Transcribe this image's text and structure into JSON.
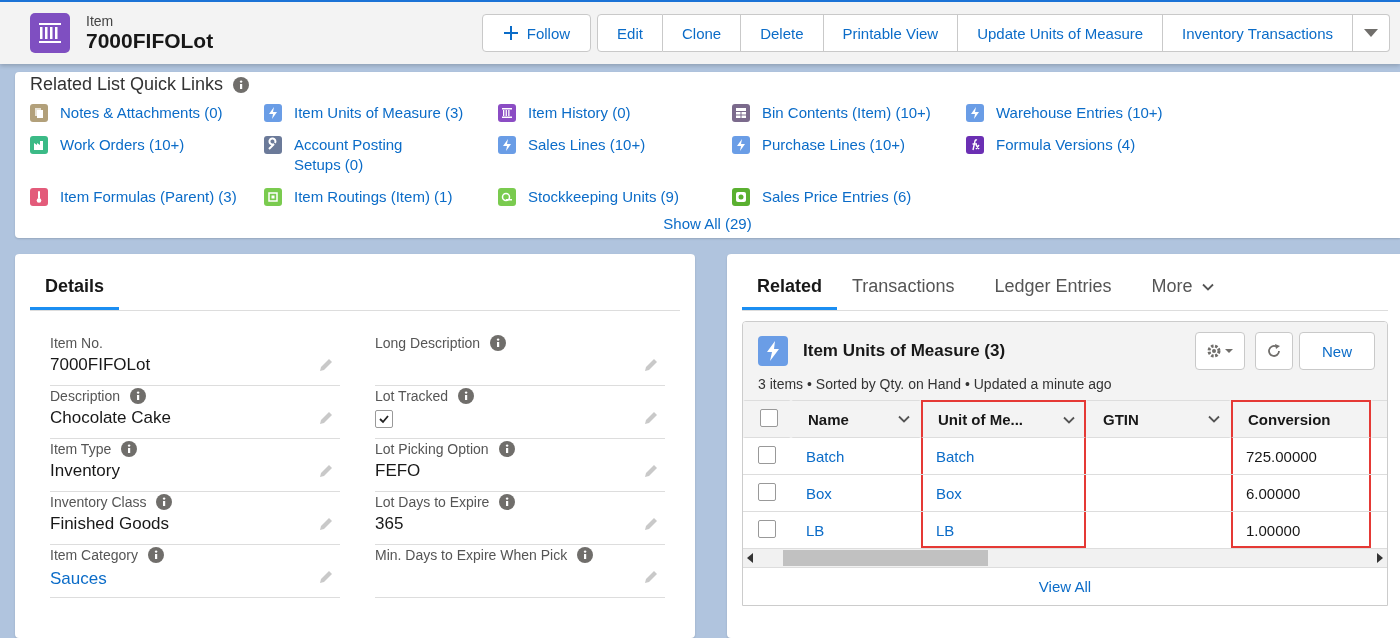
{
  "header": {
    "object_label": "Item",
    "record_name": "7000FIFOLot",
    "follow_button": "Follow",
    "actions": [
      "Edit",
      "Clone",
      "Delete",
      "Printable View",
      "Update Units of Measure",
      "Inventory Transactions"
    ]
  },
  "quick_links": {
    "title": "Related List Quick Links",
    "links": [
      {
        "label": "Notes & Attachments (0)",
        "color": "#b2a07a"
      },
      {
        "label": "Item Units of Measure (3)",
        "color": "#6a9de6"
      },
      {
        "label": "Item History (0)",
        "color": "#8b4cc4"
      },
      {
        "label": "Bin Contents (Item) (10+)",
        "color": "#7b6a8c"
      },
      {
        "label": "Warehouse Entries (10+)",
        "color": "#6a9de6"
      },
      {
        "label": "Work Orders (10+)",
        "color": "#3bba86"
      },
      {
        "label": "Account Posting Setups (0)",
        "color": "#6b7a99"
      },
      {
        "label": "Sales Lines (10+)",
        "color": "#6a9de6"
      },
      {
        "label": "Purchase Lines (10+)",
        "color": "#6a9de6"
      },
      {
        "label": "Formula Versions (4)",
        "color": "#6b2fb3"
      },
      {
        "label": "Item Formulas (Parent) (3)",
        "color": "#e35b7a"
      },
      {
        "label": "Item Routings (Item) (1)",
        "color": "#7acb4f"
      },
      {
        "label": "Stockkeeping Units (9)",
        "color": "#7acb4f"
      },
      {
        "label": "Sales Price Entries (6)",
        "color": "#5ab030"
      }
    ],
    "show_all": "Show All (29)"
  },
  "details": {
    "tab": {
      "label": "Details",
      "selected": true
    },
    "fields": [
      {
        "label": "Item No.",
        "info": false,
        "kind": "text",
        "value": "7000FIFOLot"
      },
      {
        "label": "Long Description",
        "info": true,
        "kind": "text"
      },
      {
        "label": "Description",
        "info": true,
        "kind": "text",
        "value": "Chocolate Cake"
      },
      {
        "label": "Lot Tracked",
        "info": true,
        "kind": "checkbox",
        "checked": true
      },
      {
        "label": "Item Type",
        "info": true,
        "kind": "text",
        "value": "Inventory"
      },
      {
        "label": "Lot Picking Option",
        "info": true,
        "kind": "text",
        "value": "FEFO"
      },
      {
        "label": "Inventory Class",
        "info": true,
        "kind": "text",
        "value": "Finished Goods"
      },
      {
        "label": "Lot Days to Expire",
        "info": true,
        "kind": "text",
        "value": "365"
      },
      {
        "label": "Item Category",
        "info": true,
        "kind": "link",
        "value": "Sauces"
      },
      {
        "label": "Min. Days to Expire When Pick",
        "info": true,
        "kind": "text"
      }
    ]
  },
  "related": {
    "tabs": [
      {
        "label": "Related",
        "selected": true
      },
      {
        "label": "Transactions",
        "selected": false
      },
      {
        "label": "Ledger Entries",
        "selected": false
      }
    ],
    "more_tab": {
      "label": "More",
      "selected": false
    },
    "list": {
      "title": "Item Units of Measure (3)",
      "subtitle": "3 items • Sorted by Qty. on Hand • Updated a minute ago",
      "new_button": "New",
      "all_checked": false,
      "columns": [
        {
          "label": "Name",
          "highlighted": false
        },
        {
          "label": "Unit of Me...",
          "highlighted": true
        },
        {
          "label": "GTIN",
          "highlighted": false
        },
        {
          "label": "Conversion",
          "highlighted": true
        }
      ],
      "rows": [
        {
          "checked": false,
          "cells": [
            "Batch",
            "Batch",
            "",
            "725.00000"
          ]
        },
        {
          "checked": false,
          "cells": [
            "Box",
            "Box",
            "",
            "6.00000"
          ]
        },
        {
          "checked": false,
          "cells": [
            "LB",
            "LB",
            "",
            "1.00000"
          ]
        }
      ],
      "view_all": "View All"
    }
  }
}
